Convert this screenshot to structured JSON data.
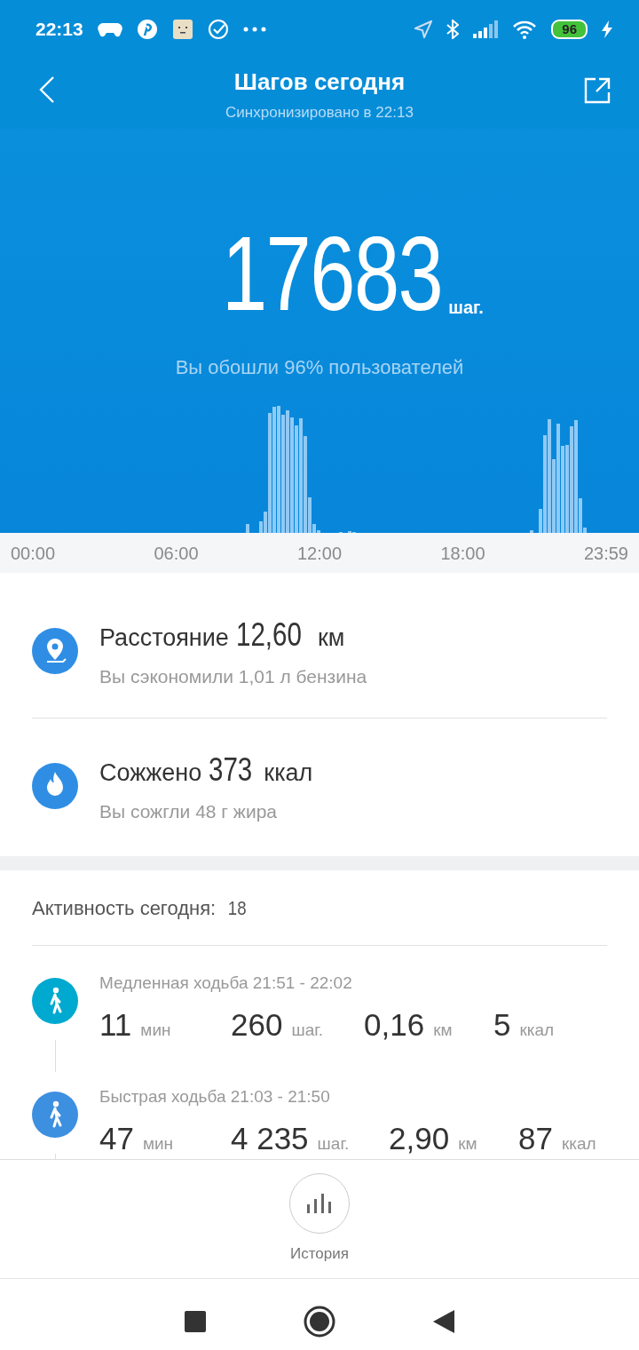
{
  "status_bar": {
    "time": "22:13",
    "battery": "96"
  },
  "header": {
    "title": "Шагов сегодня",
    "subtitle": "Синхронизировано в 22:13"
  },
  "steps": {
    "value": "17683",
    "unit": "шаг.",
    "comparison": "Вы обошли 96% пользователей"
  },
  "time_axis": [
    "00:00",
    "06:00",
    "12:00",
    "18:00",
    "23:59"
  ],
  "summary": [
    {
      "kind": "distance",
      "label": "Расстояние",
      "value": "12,60",
      "unit": "км",
      "note": "Вы сэкономили 1,01 л бензина"
    },
    {
      "kind": "calories",
      "label": "Сожжено",
      "value": "373",
      "unit": "ккал",
      "note": "Вы сожгли 48 г жира"
    }
  ],
  "activity": {
    "label": "Активность сегодня:",
    "count": "18",
    "items": [
      {
        "title": "Медленная ходьба 21:51 - 22:02",
        "color": "#00a9cf",
        "stats": [
          {
            "value": "11",
            "unit": "мин"
          },
          {
            "value": "260",
            "unit": "шаг."
          },
          {
            "value": "0,16",
            "unit": "км"
          },
          {
            "value": "5",
            "unit": "ккал"
          }
        ]
      },
      {
        "title": "Быстрая ходьба 21:03 - 21:50",
        "color": "#3d8fe0",
        "stats": [
          {
            "value": "47",
            "unit": "мин"
          },
          {
            "value": "4 235",
            "unit": "шаг."
          },
          {
            "value": "2,90",
            "unit": "км"
          },
          {
            "value": "87",
            "unit": "ккал"
          }
        ]
      }
    ]
  },
  "bottom": {
    "history_label": "История"
  }
}
